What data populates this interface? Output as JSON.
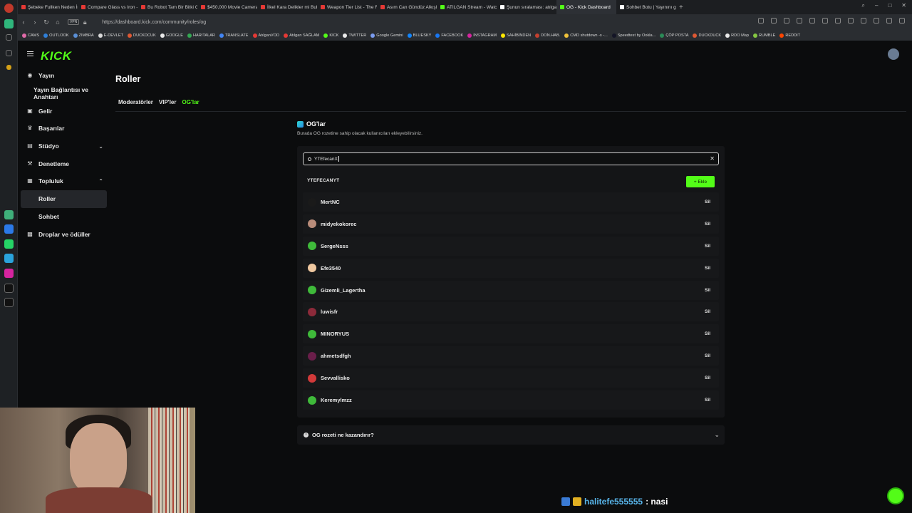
{
  "browser": {
    "tabs": [
      {
        "title": "Şebeke Fullken Neden İni",
        "color": "#e53935"
      },
      {
        "title": "Compare Glass vs Iron - Y",
        "color": "#e53935"
      },
      {
        "title": "Bu Robot Tam Bir Bitki Gil",
        "color": "#e53935"
      },
      {
        "title": "$450,000 Movie Camera",
        "color": "#e53935"
      },
      {
        "title": "İlkel Kara Delikler mi Bulu",
        "color": "#e53935"
      },
      {
        "title": "Weapon Tier List - The Fo",
        "color": "#e53935"
      },
      {
        "title": "Asım Can Gündüz Alkışlar",
        "color": "#e53935"
      },
      {
        "title": "ATILGAN Stream - Watch",
        "color": "#53fc18"
      },
      {
        "title": "Şunun sıralaması: atılgan",
        "color": "#ffffff"
      },
      {
        "title": "OG - Kick Dashboard",
        "color": "#53fc18",
        "active": true
      },
      {
        "title": "Sohbet Botu | Yayınını gü",
        "color": "#ffffff"
      }
    ],
    "new_tab": "+",
    "vpn_label": "VPN",
    "url": "https://dashboard.kick.com/community/roles/og",
    "bookmarks": [
      {
        "label": "CAMS",
        "color": "#e06aa8"
      },
      {
        "label": "OUTLOOK",
        "color": "#2f7fd8"
      },
      {
        "label": "ZIMBRA",
        "color": "#5a8fd6"
      },
      {
        "label": "E-DEVLET",
        "color": "#d9d9d9"
      },
      {
        "label": "DUCKDCUK",
        "color": "#de5833"
      },
      {
        "label": "GOOGLE",
        "color": "#eaeaea"
      },
      {
        "label": "HARITALAR",
        "color": "#34a853"
      },
      {
        "label": "TRANSLATE",
        "color": "#4285f4"
      },
      {
        "label": "AtılganVOD",
        "color": "#e53935"
      },
      {
        "label": "Atılgan SAĞLAM",
        "color": "#e53935"
      },
      {
        "label": "KICK",
        "color": "#53fc18"
      },
      {
        "label": "TWITTER",
        "color": "#eaeaea"
      },
      {
        "label": "Google Gemini",
        "color": "#7b9cf0"
      },
      {
        "label": "BLUESKY",
        "color": "#1185fe"
      },
      {
        "label": "FACEBOOK",
        "color": "#1877f2"
      },
      {
        "label": "INSTAGRAM",
        "color": "#d6249f"
      },
      {
        "label": "SAHİBİNDEN",
        "color": "#ffe800"
      },
      {
        "label": "DON.HAB.",
        "color": "#c4402f"
      },
      {
        "label": "CMD shutdown -s -...",
        "color": "#f0c23a"
      },
      {
        "label": "Speedtest by Ookla...",
        "color": "#141526"
      },
      {
        "label": "ÇÖP POSTA",
        "color": "#2b8a57"
      },
      {
        "label": "DUCKDUCK",
        "color": "#de5833"
      },
      {
        "label": "RDO Map",
        "color": "#eaeaea"
      },
      {
        "label": "RUMBLE",
        "color": "#85c742"
      },
      {
        "label": "REDDIT",
        "color": "#ff4500"
      }
    ]
  },
  "app": {
    "logo": "KICK",
    "accent": "#53fc18",
    "nav": [
      {
        "label": "Yayın",
        "icon": "broadcast-icon"
      },
      {
        "label": "Yayın Bağlantısı ve Anahtarı",
        "icon": "",
        "indent": true
      },
      {
        "label": "Gelir",
        "icon": "dollar-icon"
      },
      {
        "label": "Başarılar",
        "icon": "trophy-icon"
      },
      {
        "label": "Stüdyo",
        "icon": "studio-icon",
        "chevron": "down"
      },
      {
        "label": "Denetleme",
        "icon": "hammer-icon"
      },
      {
        "label": "Topluluk",
        "icon": "community-icon",
        "chevron": "up"
      },
      {
        "label": "Roller",
        "icon": "",
        "active": true,
        "indent": true
      },
      {
        "label": "Sohbet",
        "icon": "",
        "indent": true
      },
      {
        "label": "Droplar ve ödüller",
        "icon": "gift-icon"
      }
    ],
    "page_title": "Roller",
    "subtabs": [
      {
        "label": "Moderatörler"
      },
      {
        "label": "VIP'ler"
      },
      {
        "label": "OG'lar",
        "active": true
      }
    ],
    "og": {
      "title": "OG'lar",
      "description": "Burada OG rozetine sahip olacak kullanıcıları ekleyebilirsiniz.",
      "search_value": "YTEfecanX",
      "result_name": "YTEFECANYT",
      "add_label": "+ Ekle",
      "delete_label": "Sil",
      "users": [
        {
          "name": "MertNC",
          "avatar_color": "#1a1a1a"
        },
        {
          "name": "midyekokorec",
          "avatar_color": "#b98c7a"
        },
        {
          "name": "SergeNsss",
          "avatar_color": "#3fba3a"
        },
        {
          "name": "Efe3540",
          "avatar_color": "#f0c8a0"
        },
        {
          "name": "Gizemli_Lagertha",
          "avatar_color": "#3fba3a"
        },
        {
          "name": "luwisfr",
          "avatar_color": "#8c2a3a"
        },
        {
          "name": "MINORYUS",
          "avatar_color": "#3fba3a"
        },
        {
          "name": "ahmetsdfgh",
          "avatar_color": "#6a1e4a"
        },
        {
          "name": "Sevvallisko",
          "avatar_color": "#d23a3a"
        },
        {
          "name": "Keremylmzz",
          "avatar_color": "#3fba3a"
        }
      ],
      "faq_question": "OG rozeti ne kazandırır?"
    }
  },
  "overlay": {
    "chat_username": "halitefe555555",
    "chat_message": ": nasi"
  }
}
